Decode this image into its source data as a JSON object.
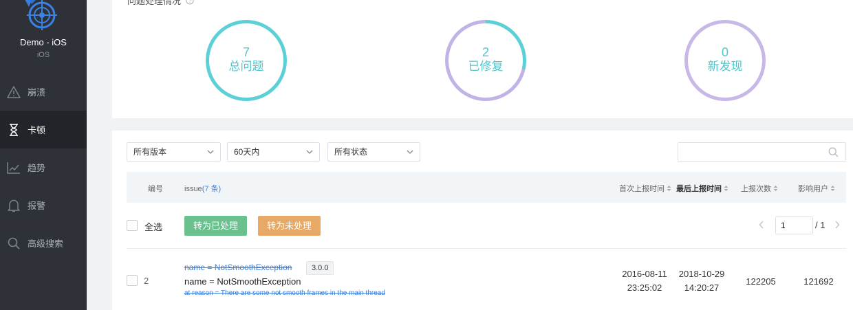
{
  "app": {
    "name": "Demo - iOS",
    "platform": "iOS"
  },
  "nav": [
    {
      "label": "崩溃",
      "icon": "warning-icon"
    },
    {
      "label": "卡顿",
      "icon": "hourglass-icon",
      "active": true
    },
    {
      "label": "趋势",
      "icon": "trend-chart-icon"
    },
    {
      "label": "报警",
      "icon": "bell-icon"
    },
    {
      "label": "高级搜索",
      "icon": "search-icon"
    }
  ],
  "stats": {
    "title": "问题处理情况",
    "total": {
      "value": "7",
      "label": "总问题"
    },
    "fixed": {
      "value": "2",
      "label": "已修复",
      "fraction": 0.286
    },
    "new": {
      "value": "0",
      "label": "新发现"
    }
  },
  "filters": {
    "version": "所有版本",
    "range": "60天内",
    "status": "所有状态",
    "search_value": ""
  },
  "table": {
    "headers": {
      "no": "编号",
      "issue": "issue",
      "issue_count": "(7 条)",
      "first_report": "首次上报时间",
      "last_report": "最后上报时间",
      "report_count": "上报次数",
      "affected_users": "影响用户"
    },
    "select_all": "全选",
    "btn_processed": "转为已处理",
    "btn_unprocessed": "转为未处理",
    "pager": {
      "current": "1",
      "total": "/ 1"
    },
    "rows": [
      {
        "no": "2",
        "title_struck": "name = NotSmoothException",
        "version": "3.0.0",
        "name": "name = NotSmoothException",
        "reason": "at reason = There are some not smooth frames in the main thread",
        "first_date": "2016-08-11",
        "first_time": "23:25:02",
        "last_date": "2018-10-29",
        "last_time": "14:20:27",
        "report_count": "122205",
        "affected_users": "121692"
      }
    ]
  },
  "colors": {
    "sidebar_bg": "#2e3238",
    "ring_teal": "#5cd0d6",
    "ring_purple": "#c7b8e8",
    "btn_green": "#6ac18e",
    "btn_orange": "#e8a866",
    "link_blue": "#3b7dd8"
  }
}
